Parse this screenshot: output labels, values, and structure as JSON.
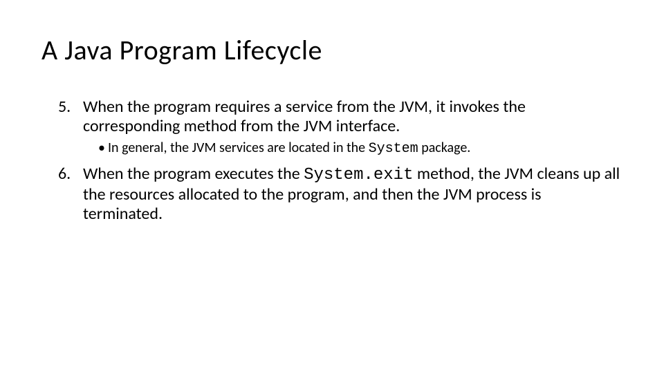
{
  "title": "A Java Program Lifecycle",
  "items": [
    {
      "num": "5.",
      "text_before": "When the program requires a service from the JVM, it invokes the corresponding method from the JVM interface.",
      "sub": {
        "prefix": "In general, the JVM services are located in the ",
        "code": "System",
        "suffix": " package."
      }
    },
    {
      "num": "6.",
      "text_before": "When the program executes the ",
      "code": "System.exit",
      "text_after": " method, the JVM cleans up all the resources allocated to the program, and then the JVM process is terminated."
    }
  ]
}
